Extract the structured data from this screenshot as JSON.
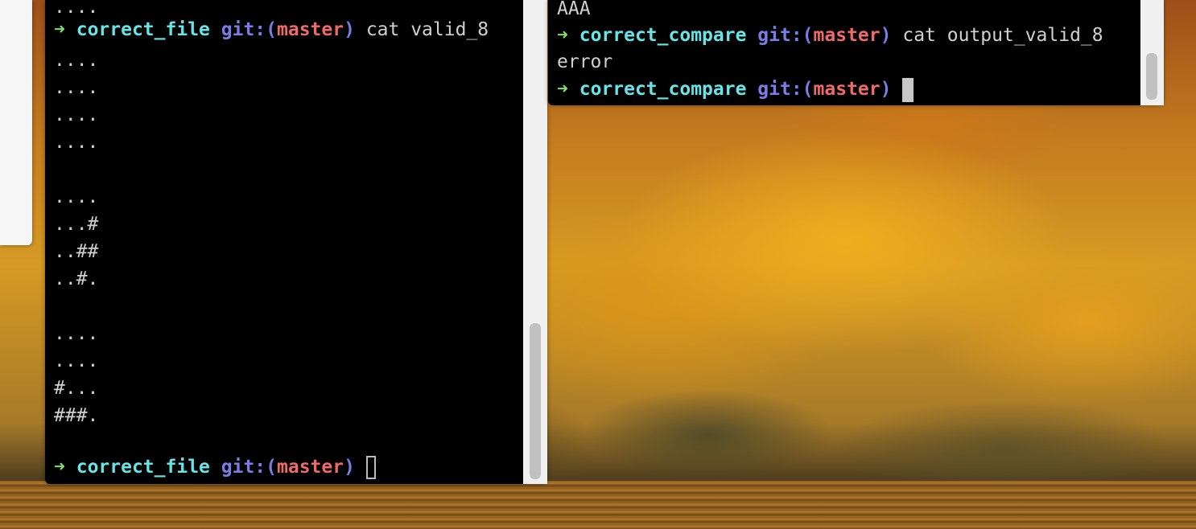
{
  "left_terminal": {
    "first_line": "....",
    "prompt": {
      "arrow": "➜",
      "dir": "correct_file",
      "git": "git:(",
      "branch": "master",
      "close": ")"
    },
    "command": "cat valid_8",
    "output": [
      "....",
      "....",
      "....",
      "....",
      "",
      "....",
      "...#",
      "..##",
      "..#.",
      "",
      "....",
      "....",
      "#...",
      "###."
    ],
    "final_prompt": {
      "arrow": "➜",
      "dir": "correct_file",
      "git": "git:(",
      "branch": "master",
      "close": ")"
    }
  },
  "right_terminal": {
    "first_line": "AAA",
    "prompt": {
      "arrow": "➜",
      "dir": "correct_compare",
      "git": "git:(",
      "branch": "master",
      "close": ")"
    },
    "command": "cat output_valid_8",
    "output": "error",
    "final_prompt": {
      "arrow": "➜",
      "dir": "correct_compare",
      "git": "git:(",
      "branch": "master",
      "close": ")"
    }
  }
}
